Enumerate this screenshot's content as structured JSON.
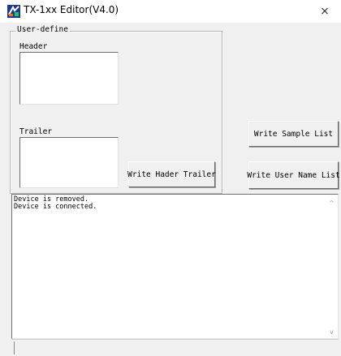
{
  "window": {
    "title": "TX-1xx Editor(V4.0)",
    "close_glyph": "×",
    "icon": "app-logo-icon"
  },
  "user_define": {
    "legend": "User-define",
    "header_label": "Header",
    "trailer_label": "Trailer",
    "header_value": "",
    "trailer_value": "",
    "write_button": "Write Hader Trailer"
  },
  "actions": {
    "write_sample_list": "Write Sample List",
    "write_user_name_list": "Write User Name List"
  },
  "log": {
    "lines": [
      "Device is removed.",
      "Device is connected."
    ],
    "scroll_up_glyph": "^",
    "scroll_down_glyph": "v"
  },
  "colors": {
    "window_bg": "#f0f0f0",
    "titlebar_bg": "#ffffff",
    "field_bg": "#ffffff"
  }
}
